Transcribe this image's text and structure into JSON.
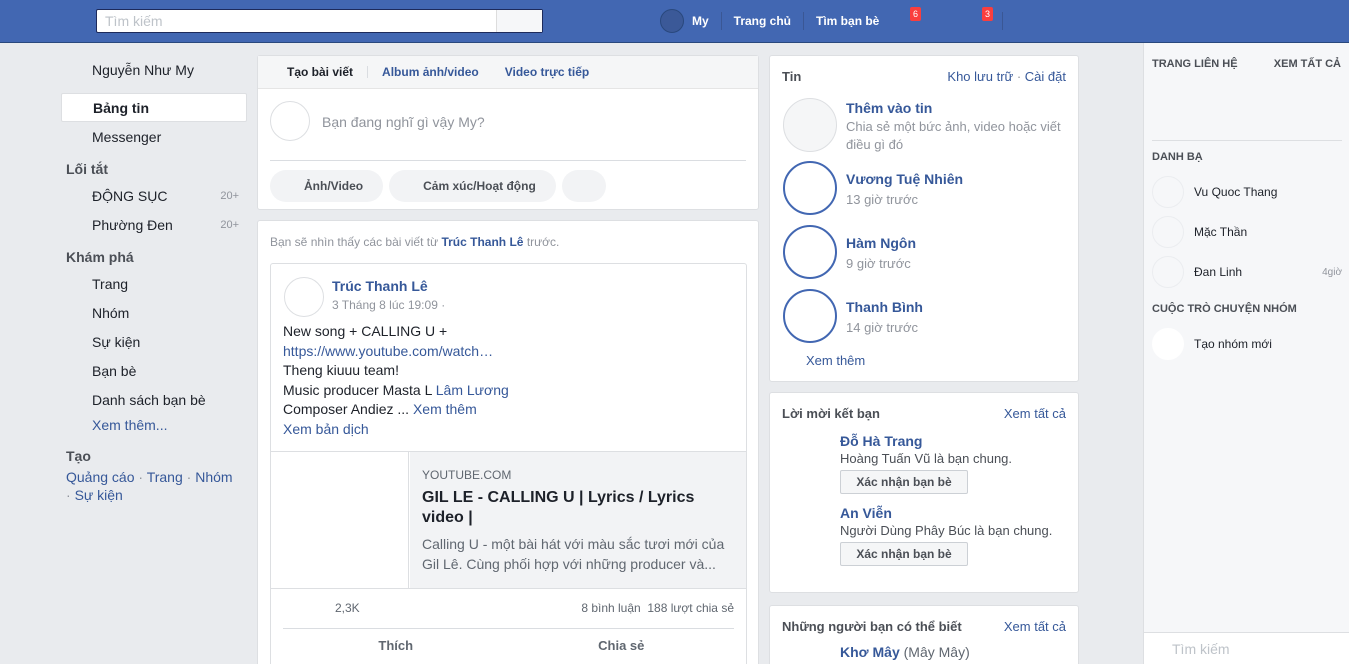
{
  "topbar": {
    "search_placeholder": "Tìm kiếm",
    "profile_name": "My",
    "home_label": "Trang chủ",
    "find_friends_label": "Tìm bạn bè",
    "badge_messages": "6",
    "badge_notifications": "3"
  },
  "leftnav": {
    "profile_name": "Nguyễn Như My",
    "news_feed": "Bảng tin",
    "messenger": "Messenger",
    "shortcuts_header": "Lối tắt",
    "shortcuts": [
      {
        "label": "ĐỘNG SỤC",
        "count": "20+"
      },
      {
        "label": "Phường Đen",
        "count": "20+"
      }
    ],
    "explore_header": "Khám phá",
    "explore": [
      "Trang",
      "Nhóm",
      "Sự kiện",
      "Bạn bè",
      "Danh sách bạn bè"
    ],
    "see_more": "Xem thêm...",
    "create_header": "Tạo",
    "create_links": [
      "Quảng cáo",
      "Trang",
      "Nhóm",
      "Sự kiện"
    ],
    "create_separator": " · "
  },
  "composer": {
    "tab_create": "Tạo bài viết",
    "tab_album": "Album ảnh/video",
    "tab_live": "Video trực tiếp",
    "placeholder": "Bạn đang nghĩ gì vậy My?",
    "action_photo": "Ảnh/Video",
    "action_feeling": "Cảm xúc/Hoạt động"
  },
  "feed": {
    "notice_prefix": "Bạn sẽ nhìn thấy các bài viết từ ",
    "notice_name": "Trúc Thanh Lê",
    "notice_suffix": " trước.",
    "post": {
      "author": "Trúc Thanh Lê",
      "time": "3 Tháng 8 lúc 19:09 ·",
      "line1": "New song + CALLING U +",
      "link": "https://www.youtube.com/watch…",
      "line3": "Theng kiuuu team!",
      "line4_prefix": "Music producer Masta L ",
      "line4_tag": "Lâm Lương",
      "line5_prefix": "Composer Andiez ... ",
      "line5_more": "Xem thêm",
      "translate": "Xem bản dịch",
      "preview_domain": "YOUTUBE.COM",
      "preview_title": "GIL LE - CALLING U | Lyrics / Lyrics video |",
      "preview_desc": "Calling U - một bài hát với màu sắc tươi mới của Gil Lê. Cùng phối hợp với những producer và...",
      "likes": "2,3K",
      "comments": "8 bình luận",
      "shares": "188 lượt chia sẻ",
      "like_label": "Thích",
      "share_label": "Chia sẻ"
    }
  },
  "stories": {
    "header": "Tin",
    "archive": "Kho lưu trữ",
    "settings": "Cài đặt",
    "separator": " · ",
    "add_title": "Thêm vào tin",
    "add_desc": "Chia sẻ một bức ảnh, video hoặc viết điều gì đó",
    "items": [
      {
        "name": "Vương Tuệ Nhiên",
        "time": "13 giờ trước"
      },
      {
        "name": "Hàm Ngôn",
        "time": "9 giờ trước"
      },
      {
        "name": "Thanh Bình",
        "time": "14 giờ trước"
      }
    ],
    "see_more": "Xem thêm"
  },
  "requests": {
    "header": "Lời mời kết bạn",
    "see_all": "Xem tất cả",
    "items": [
      {
        "name": "Đỗ Hà Trang",
        "mutual": "Hoàng Tuấn Vũ là bạn chung.",
        "button": "Xác nhận bạn bè"
      },
      {
        "name": "An Viễn",
        "mutual": "Người Dùng Phây Búc là bạn chung.",
        "button": "Xác nhận bạn bè"
      }
    ]
  },
  "pymk": {
    "header": "Những người bạn có thể biết",
    "see_all": "Xem tất cả",
    "first_name": "Khơ Mây",
    "first_alias": " (Mây Mây)"
  },
  "chat": {
    "contacts_page_header": "TRANG LIÊN HỆ",
    "see_all": "XEM TẤT CẢ",
    "directory_header": "DANH BẠ",
    "contacts": [
      {
        "name": "Vu Quoc Thang",
        "time": ""
      },
      {
        "name": "Mặc Thần",
        "time": ""
      },
      {
        "name": "Đan Linh",
        "time": "4giờ"
      }
    ],
    "group_header": "CUỘC TRÒ CHUYỆN NHÓM",
    "new_group": "Tạo nhóm mới",
    "search_placeholder": "Tìm kiếm"
  }
}
